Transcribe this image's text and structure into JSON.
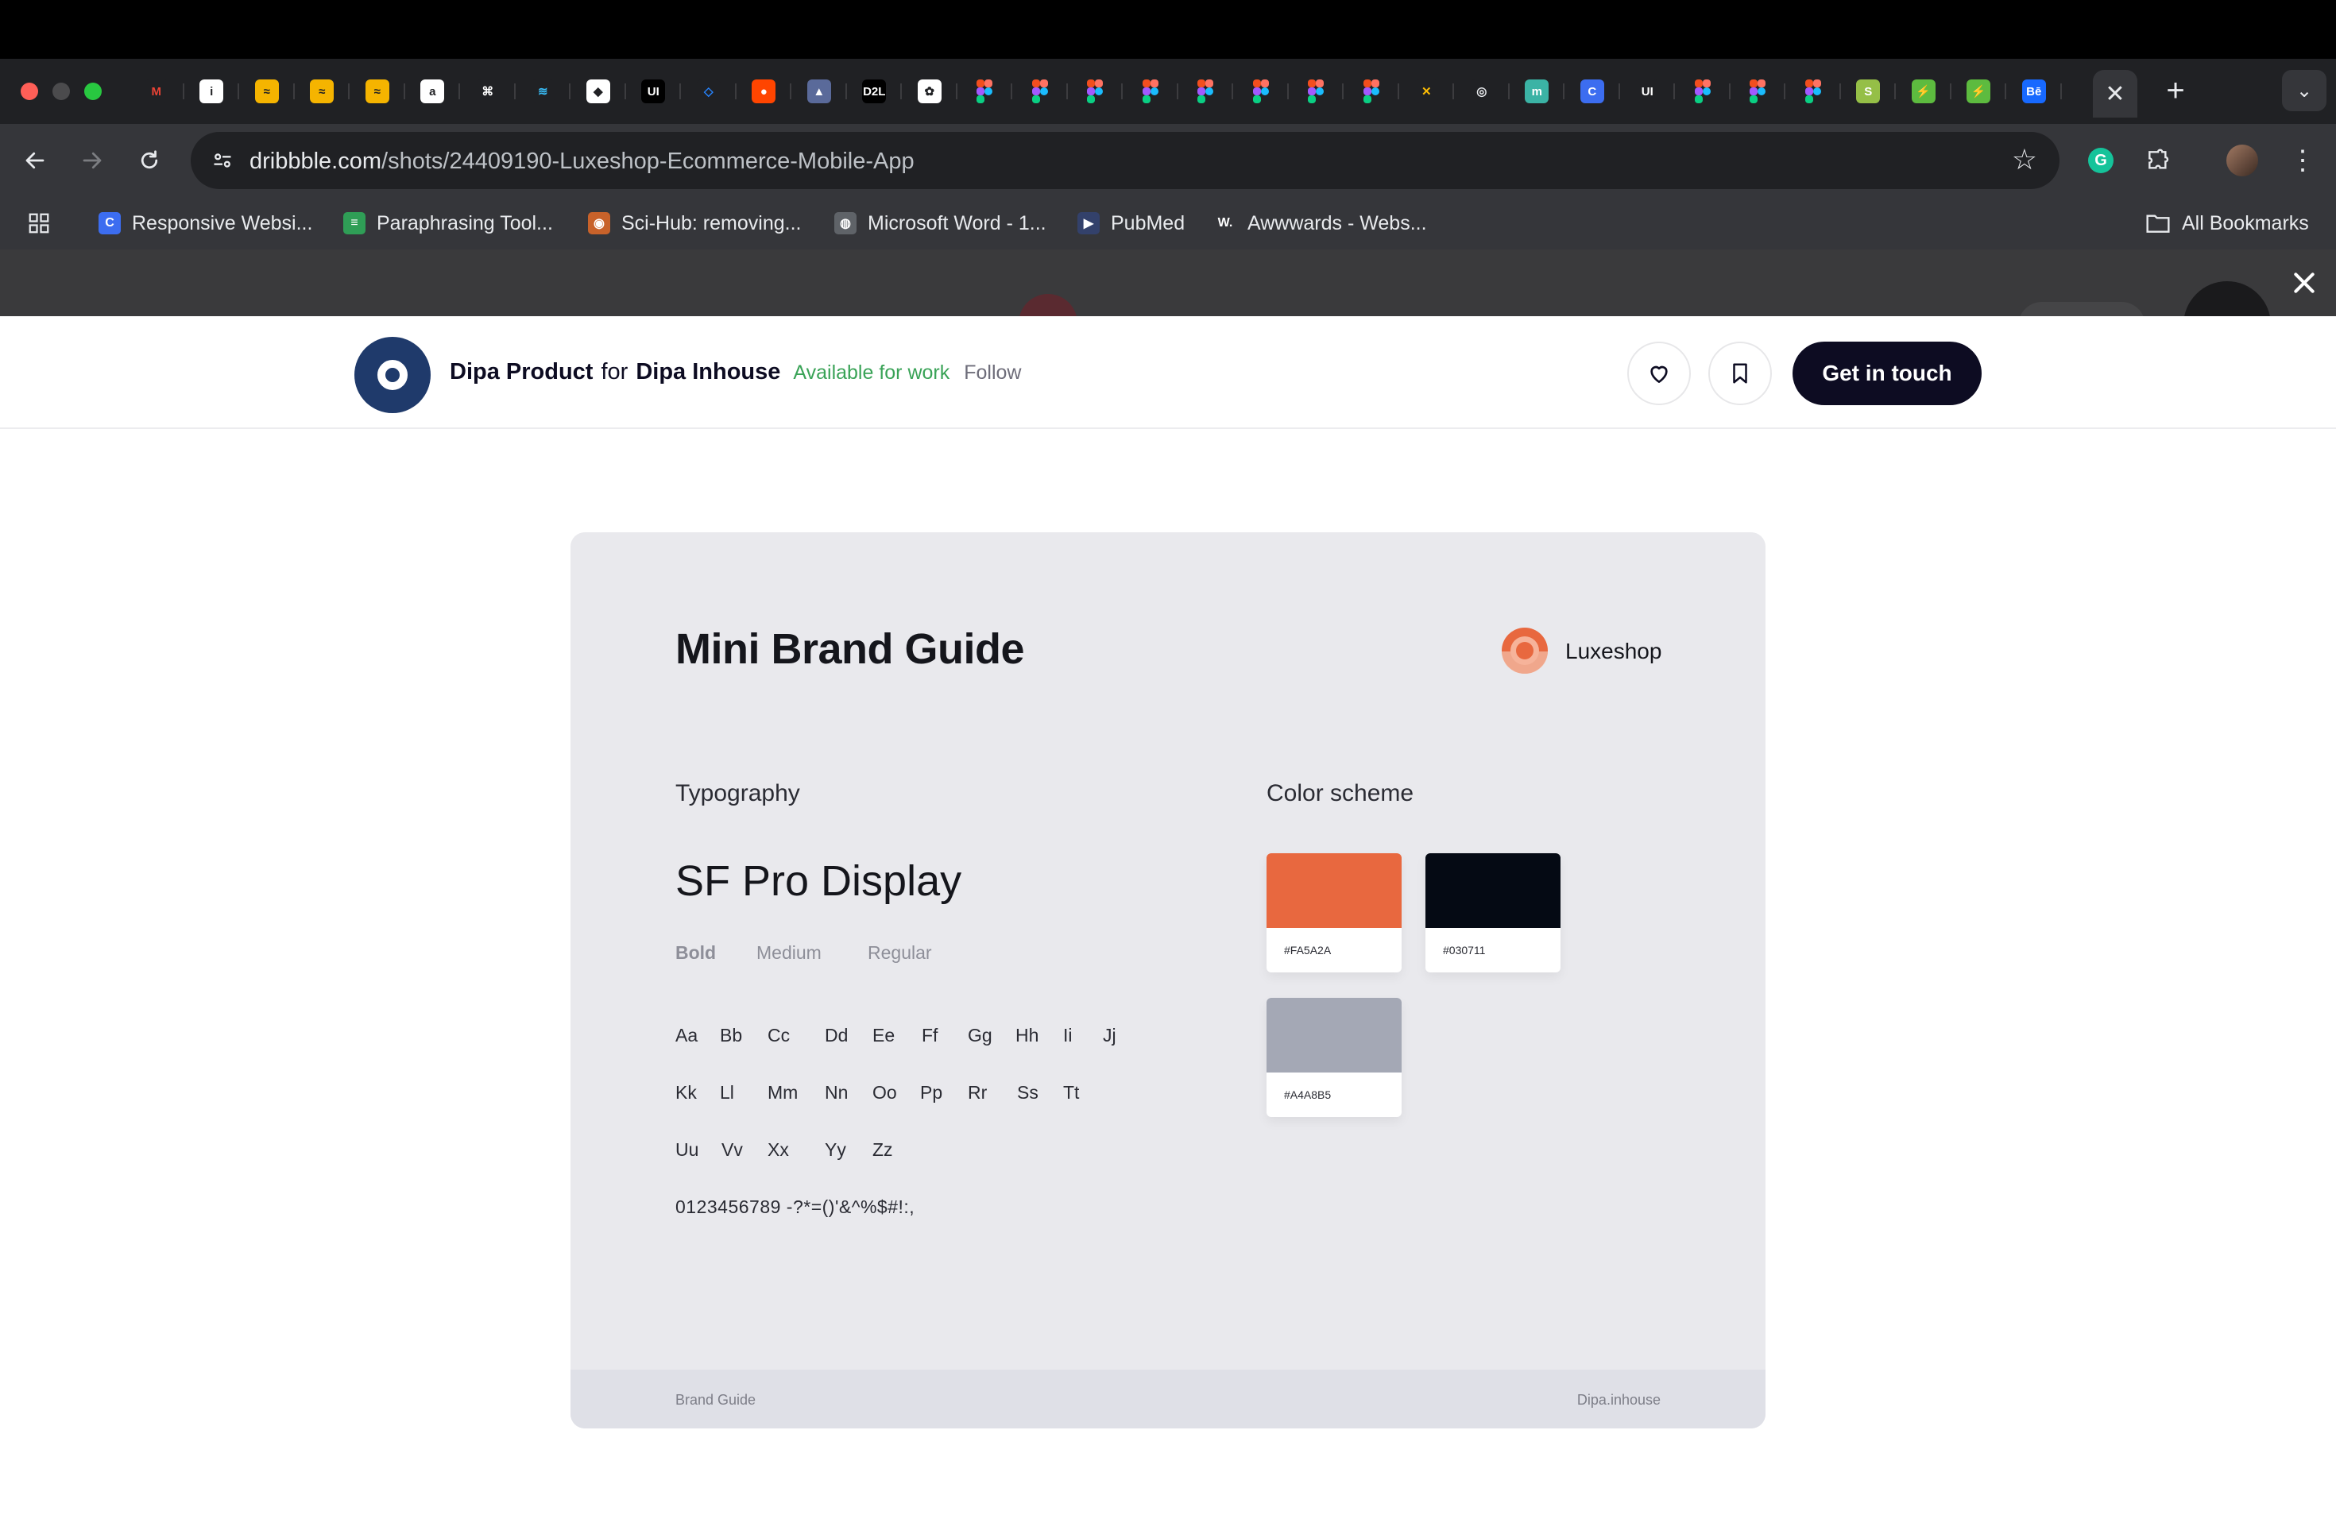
{
  "browser": {
    "tab_favicons": [
      {
        "name": "gmail",
        "glyph": "M",
        "bg": "#202124",
        "fg": "#ea4335"
      },
      {
        "name": "info",
        "glyph": "i",
        "bg": "#ffffff",
        "fg": "#202124"
      },
      {
        "name": "paraphrase-1",
        "glyph": "≈",
        "bg": "#f5b400",
        "fg": "#202124"
      },
      {
        "name": "paraphrase-2",
        "glyph": "≈",
        "bg": "#f5b400",
        "fg": "#202124"
      },
      {
        "name": "paraphrase-3",
        "glyph": "≈",
        "bg": "#f5b400",
        "fg": "#202124"
      },
      {
        "name": "amazon",
        "glyph": "a",
        "bg": "#ffffff",
        "fg": "#202124"
      },
      {
        "name": "chatgpt-like",
        "glyph": "⌘",
        "bg": "#202124",
        "fg": "#ffffff"
      },
      {
        "name": "tailwind",
        "glyph": "≋",
        "bg": "#202124",
        "fg": "#38bdf8"
      },
      {
        "name": "codesandbox",
        "glyph": "◆",
        "bg": "#ffffff",
        "fg": "#202124"
      },
      {
        "name": "uiverse",
        "glyph": "UI",
        "bg": "#000000",
        "fg": "#ffffff"
      },
      {
        "name": "jira",
        "glyph": "◇",
        "bg": "#202124",
        "fg": "#2684ff"
      },
      {
        "name": "reddit",
        "glyph": "●",
        "bg": "#ff4500",
        "fg": "#ffffff"
      },
      {
        "name": "image",
        "glyph": "▲",
        "bg": "#5a6a9a",
        "fg": "#ffffff"
      },
      {
        "name": "d2l",
        "glyph": "D2L",
        "bg": "#000000",
        "fg": "#ffffff"
      },
      {
        "name": "openai",
        "glyph": "✿",
        "bg": "#ffffff",
        "fg": "#202124"
      },
      {
        "name": "figma-1",
        "glyph": "figma",
        "bg": "",
        "fg": ""
      },
      {
        "name": "figma-2",
        "glyph": "figma",
        "bg": "",
        "fg": ""
      },
      {
        "name": "figma-3",
        "glyph": "figma",
        "bg": "",
        "fg": ""
      },
      {
        "name": "figma-4",
        "glyph": "figma",
        "bg": "",
        "fg": ""
      },
      {
        "name": "figma-5",
        "glyph": "figma",
        "bg": "",
        "fg": ""
      },
      {
        "name": "figma-6",
        "glyph": "figma",
        "bg": "",
        "fg": ""
      },
      {
        "name": "figma-7",
        "glyph": "figma",
        "bg": "",
        "fg": ""
      },
      {
        "name": "figma-8",
        "glyph": "figma",
        "bg": "",
        "fg": ""
      },
      {
        "name": "multicolor",
        "glyph": "✕",
        "bg": "#202124",
        "fg": "#fbbc04"
      },
      {
        "name": "chrome",
        "glyph": "◎",
        "bg": "#202124",
        "fg": "#e8eaed"
      },
      {
        "name": "teal",
        "glyph": "m",
        "bg": "#3bb3a5",
        "fg": "#ffffff"
      },
      {
        "name": "canva",
        "glyph": "C",
        "bg": "#3c6df0",
        "fg": "#ffffff"
      },
      {
        "name": "ui-2",
        "glyph": "UI",
        "bg": "#202124",
        "fg": "#ffffff"
      },
      {
        "name": "figma-9",
        "glyph": "figma",
        "bg": "",
        "fg": ""
      },
      {
        "name": "figma-10",
        "glyph": "figma",
        "bg": "",
        "fg": ""
      },
      {
        "name": "figma-11",
        "glyph": "figma",
        "bg": "",
        "fg": ""
      },
      {
        "name": "shopify",
        "glyph": "S",
        "bg": "#95bf47",
        "fg": "#ffffff"
      },
      {
        "name": "green-1",
        "glyph": "⚡",
        "bg": "#5dbb3f",
        "fg": "#ffffff"
      },
      {
        "name": "green-2",
        "glyph": "⚡",
        "bg": "#5dbb3f",
        "fg": "#ffffff"
      },
      {
        "name": "behance",
        "glyph": "Bē",
        "bg": "#1769ff",
        "fg": "#ffffff"
      }
    ],
    "active_tab_close": "✕",
    "new_tab": "+",
    "tab_search": "⌄",
    "url_host": "dribbble.com",
    "url_path": "/shots/24409190-Luxeshop-Ecommerce-Mobile-App",
    "bookmarks": [
      {
        "label": "Responsive Websi...",
        "icon": "C",
        "icon_bg": "#3c6df0"
      },
      {
        "label": "Paraphrasing Tool...",
        "icon": "≡",
        "icon_bg": "#2f9e56"
      },
      {
        "label": "Sci-Hub: removing...",
        "icon": "◉",
        "icon_bg": "#c8622a"
      },
      {
        "label": "Microsoft Word - 1...",
        "icon": "◍",
        "icon_bg": "#5f6368"
      },
      {
        "label": "PubMed",
        "icon": "▶",
        "icon_bg": "#33416b"
      },
      {
        "label": "Awwwards - Webs...",
        "icon": "W.",
        "icon_bg": "#35363a"
      }
    ],
    "all_bookmarks": "All Bookmarks"
  },
  "shot_header": {
    "author": "Dipa Product",
    "for_word": "for",
    "team": "Dipa Inhouse",
    "available": "Available for work",
    "follow": "Follow",
    "cta": "Get in touch"
  },
  "brand_guide": {
    "title": "Mini Brand Guide",
    "brand_name": "Luxeshop",
    "typography_heading": "Typography",
    "font_name": "SF Pro Display",
    "weights": [
      "Bold",
      "Medium",
      "Regular"
    ],
    "glyph_rows": [
      [
        "Aa",
        "Bb",
        "Cc",
        "Dd",
        "Ee",
        "Ff",
        "Gg",
        "Hh",
        "Ii",
        "Jj"
      ],
      [
        "Kk",
        "Ll",
        "Mm",
        "Nn",
        "Oo",
        "Pp",
        "Rr",
        "Ss",
        "Tt"
      ],
      [
        "Uu",
        "Vv",
        "Xx",
        "Yy",
        "Zz"
      ]
    ],
    "digits": "0123456789 -?*=()'&^%$#!:,",
    "color_heading": "Color scheme",
    "colors": [
      {
        "hex_label": "#FA5A2A",
        "swatch": "#e8683f"
      },
      {
        "hex_label": "#030711",
        "swatch": "#050a14"
      },
      {
        "hex_label": "#A4A8B5",
        "swatch": "#a4a8b5"
      }
    ],
    "footer_left": "Brand Guide",
    "footer_right": "Dipa.inhouse"
  }
}
